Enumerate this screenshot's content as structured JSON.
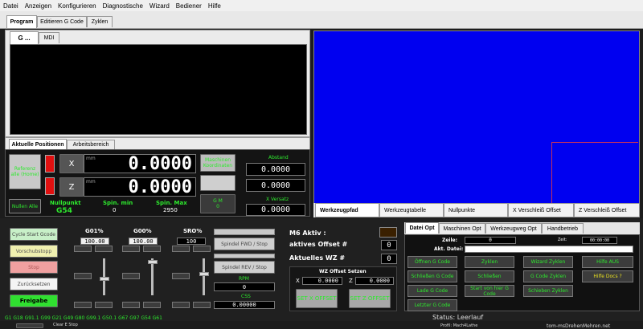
{
  "menu": [
    "Datei",
    "Anzeigen",
    "Konfigurieren",
    "Diagnostische",
    "Wizard",
    "Bediener",
    "Hilfe"
  ],
  "main_tabs": [
    "Program",
    "Editieren G Code",
    "Zyklen"
  ],
  "prog_tabs": [
    "G ...",
    "MDI"
  ],
  "pos_tabs": [
    "Aktuelle Positionen",
    "Arbeitsbereich"
  ],
  "positions": {
    "ref_button": "Referenz alle (Home)",
    "x_axis": "X",
    "x_unit": "mm",
    "x_value": "0.0000",
    "z_axis": "Z",
    "z_unit": "mm",
    "z_value": "0.0000",
    "zero_all": "Nullen Alle",
    "nullpunkt_label": "Nullpunkt",
    "nullpunkt_value": "G54",
    "spin_min_label": "Spin. min",
    "spin_min_value": "0",
    "spin_max_label": "Spin. Max",
    "spin_max_value": "2950",
    "machine_coords_btn": "Maschinen Koordinaten",
    "gm_btn": "G M",
    "gm_value": "0",
    "abstand_label": "Abstand",
    "abstand_value1": "0.0000",
    "abstand_value2": "0.0000",
    "xversatz_label": "X Versatz",
    "xversatz_value": "0.0000"
  },
  "view_tabs": [
    "Werkzeugpfad",
    "Werkzeugtabelle",
    "Nullpunkte",
    "X Verschleiß Offset",
    "Z Verschleiß Offset"
  ],
  "controls": {
    "cycle_start": "Cycle Start Gcode",
    "vorschub": "Vorschubstopp",
    "stop": "Stop",
    "reset": "Zurücksetzen",
    "freigabe": "Freigabe",
    "g01_label": "G01%",
    "g01_value": "100.00",
    "g00_label": "G00%",
    "g00_value": "100.00",
    "sro_label": "SRO%",
    "sro_value": "100",
    "spindle_btn1": "Spindel FWD / Stop",
    "spindle_btn2": "Spindel REV / Stop",
    "rpm_label": "RPM",
    "rpm_value": "0",
    "css_label": "CSS",
    "css_value": "0.00000",
    "small_btn": "Btn"
  },
  "wz": {
    "m6_label": "M6 Aktiv :",
    "offset_label": "aktives Offset #",
    "offset_value": "0",
    "wz_label": "Aktuelles WZ #",
    "wz_value": "0",
    "setzen_label": "WZ Offset Setzen",
    "x_label": "X",
    "x_value": "0.0000",
    "z_label": "Z",
    "z_value": "0.0000",
    "set_x": "SET X OFFSET",
    "set_z": "SET Z OFFSET"
  },
  "right_tabs": [
    "Datei Opt",
    "Maschinen Opt",
    "Werkzeugweg Opt",
    "Handbetrieb"
  ],
  "file_opt": {
    "zeile_label": "Zeile:",
    "zeile_value": "0",
    "zeit_label": "Zeit:",
    "zeit_value": "00:00:00",
    "datei_label": "Akt. Datei:",
    "b1": "Öffnen G Code",
    "b2": "Schließen G Code",
    "b3": "Lade G Code",
    "b4": "Letzter G Code",
    "b5": "Zyklen",
    "b6": "Schließen",
    "b7": "Wizard Zyklen",
    "b8": "G Code Zyklen",
    "b9": "Schieben Zyklen",
    "b10": "Start von hier G Code",
    "aus_btn": "Hilfe AUS",
    "hilfe_btn": "Hilfe Docs ?"
  },
  "status": {
    "gcodes": "G1 G18 G91.1 G99 G21 G49 G80 G99.1 G50.1 G67 G97 G54 G61",
    "status_label": "Status: Leerlauf",
    "clear_btn": "Clear E Stop",
    "profil": "Profil: Mach4Lathe",
    "url": "tom-msDrehenMehren.net"
  },
  "colors": {
    "view_bg": "#0000f0",
    "green": "#2eea2e",
    "red": "#e01010",
    "dro_bg": "#000000"
  }
}
